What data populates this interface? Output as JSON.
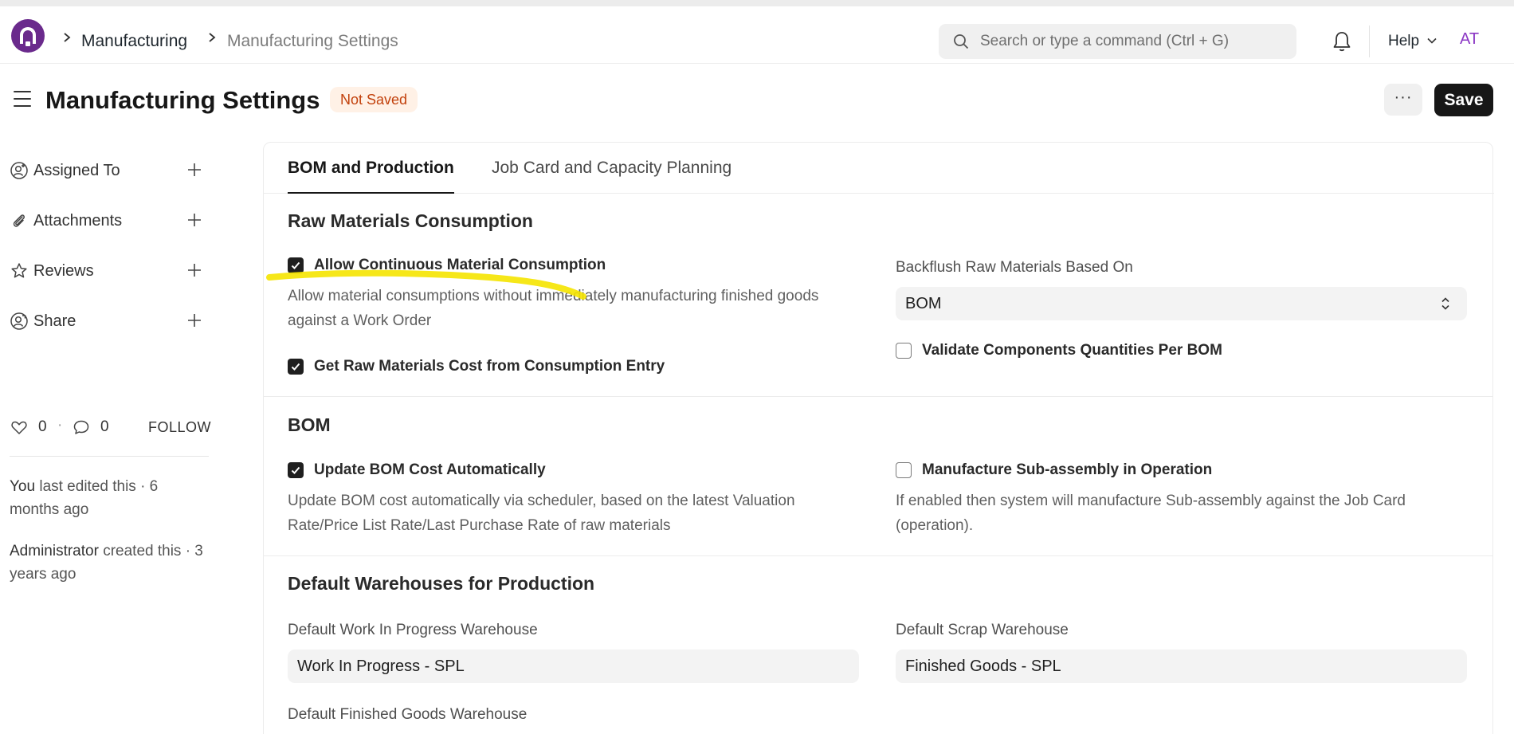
{
  "breadcrumbs": [
    "Manufacturing",
    "Manufacturing Settings"
  ],
  "search": {
    "placeholder": "Search or type a command (Ctrl + G)"
  },
  "help_label": "Help",
  "avatar_initials": "AT",
  "page": {
    "title": "Manufacturing Settings",
    "status": "Not Saved",
    "more_label": "···",
    "save_label": "Save"
  },
  "sidebar": {
    "items": [
      {
        "label": "Assigned To",
        "icon": "user-add-icon"
      },
      {
        "label": "Attachments",
        "icon": "paperclip-icon"
      },
      {
        "label": "Reviews",
        "icon": "star-icon"
      },
      {
        "label": "Share",
        "icon": "share-user-icon"
      }
    ],
    "likes": "0",
    "dot": "·",
    "comments": "0",
    "follow_label": "FOLLOW",
    "activity": [
      {
        "actor": "You",
        "text": " last edited this · 6 months ago"
      },
      {
        "actor": "Administrator",
        "text": " created this · 3 years ago"
      }
    ]
  },
  "tabs": [
    {
      "label": "BOM and Production",
      "active": true
    },
    {
      "label": "Job Card and Capacity Planning",
      "active": false
    }
  ],
  "sections": {
    "raw_materials": {
      "title": "Raw Materials Consumption",
      "allow_continuous": {
        "label": "Allow Continuous Material Consumption",
        "checked": true,
        "description": "Allow material consumptions without immediately manufacturing finished goods against a Work Order"
      },
      "get_raw_cost": {
        "label": "Get Raw Materials Cost from Consumption Entry",
        "checked": true
      },
      "backflush": {
        "label": "Backflush Raw Materials Based On",
        "value": "BOM"
      },
      "validate_components": {
        "label": "Validate Components Quantities Per BOM",
        "checked": false
      }
    },
    "bom": {
      "title": "BOM",
      "update_cost": {
        "label": "Update BOM Cost Automatically",
        "checked": true,
        "description": "Update BOM cost automatically via scheduler, based on the latest Valuation Rate/Price List Rate/Last Purchase Rate of raw materials"
      },
      "manufacture_subassembly": {
        "label": "Manufacture Sub-assembly in Operation",
        "checked": false,
        "description": "If enabled then system will manufacture Sub-assembly against the Job Card (operation)."
      }
    },
    "warehouses": {
      "title": "Default Warehouses for Production",
      "wip": {
        "label": "Default Work In Progress Warehouse",
        "value": "Work In Progress - SPL"
      },
      "scrap": {
        "label": "Default Scrap Warehouse",
        "value": "Finished Goods - SPL"
      },
      "finished": {
        "label": "Default Finished Goods Warehouse"
      }
    }
  },
  "colors": {
    "brand": "#6a2a8c",
    "status_bg": "#fff1e6",
    "status_text": "#c2410c",
    "highlight": "#f5e400"
  }
}
